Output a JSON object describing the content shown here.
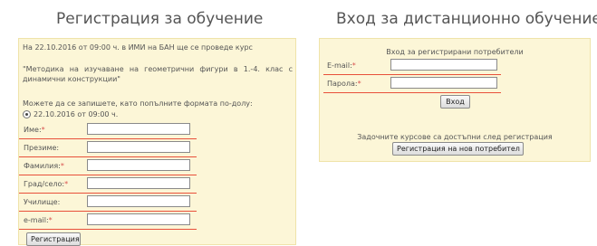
{
  "registration": {
    "title": "Регистрация за обучение",
    "intro": "На 22.10.2016 от 09:00 ч. в ИМИ на БАН ще се проведе курс",
    "course_name": "\"Методика на изучаване на геометрични фигури в 1.-4. клас с динамични конструкции\"",
    "signup_prompt": "Можете да се запишете, като попълните формата по-долу:",
    "session_option": "22.10.2016 от 09:00 ч.",
    "fields": [
      {
        "label": "Име:",
        "required": "*",
        "value": ""
      },
      {
        "label": "Презиме:",
        "required": "",
        "value": ""
      },
      {
        "label": "Фамилия:",
        "required": "*",
        "value": ""
      },
      {
        "label": "Град/село:",
        "required": "*",
        "value": ""
      },
      {
        "label": "Училище:",
        "required": "",
        "value": ""
      },
      {
        "label": "e-mail:",
        "required": "*",
        "value": ""
      }
    ],
    "submit_label": "Регистрация"
  },
  "login": {
    "title": "Вход за дистанционно обучение",
    "subtitle": "Вход за регистрирани потребители",
    "fields": [
      {
        "label": "E-mail:",
        "required": "*",
        "value": ""
      },
      {
        "label": "Парола:",
        "required": "*",
        "value": ""
      }
    ],
    "login_label": "Вход",
    "courses_note": "Задочните курсове са достъпни след регистрация",
    "new_user_label": "Регистрация на нов потребител"
  },
  "colors": {
    "panel_bg": "#fcf6d7",
    "panel_border": "#efe3a9",
    "underline": "#e8503a"
  }
}
